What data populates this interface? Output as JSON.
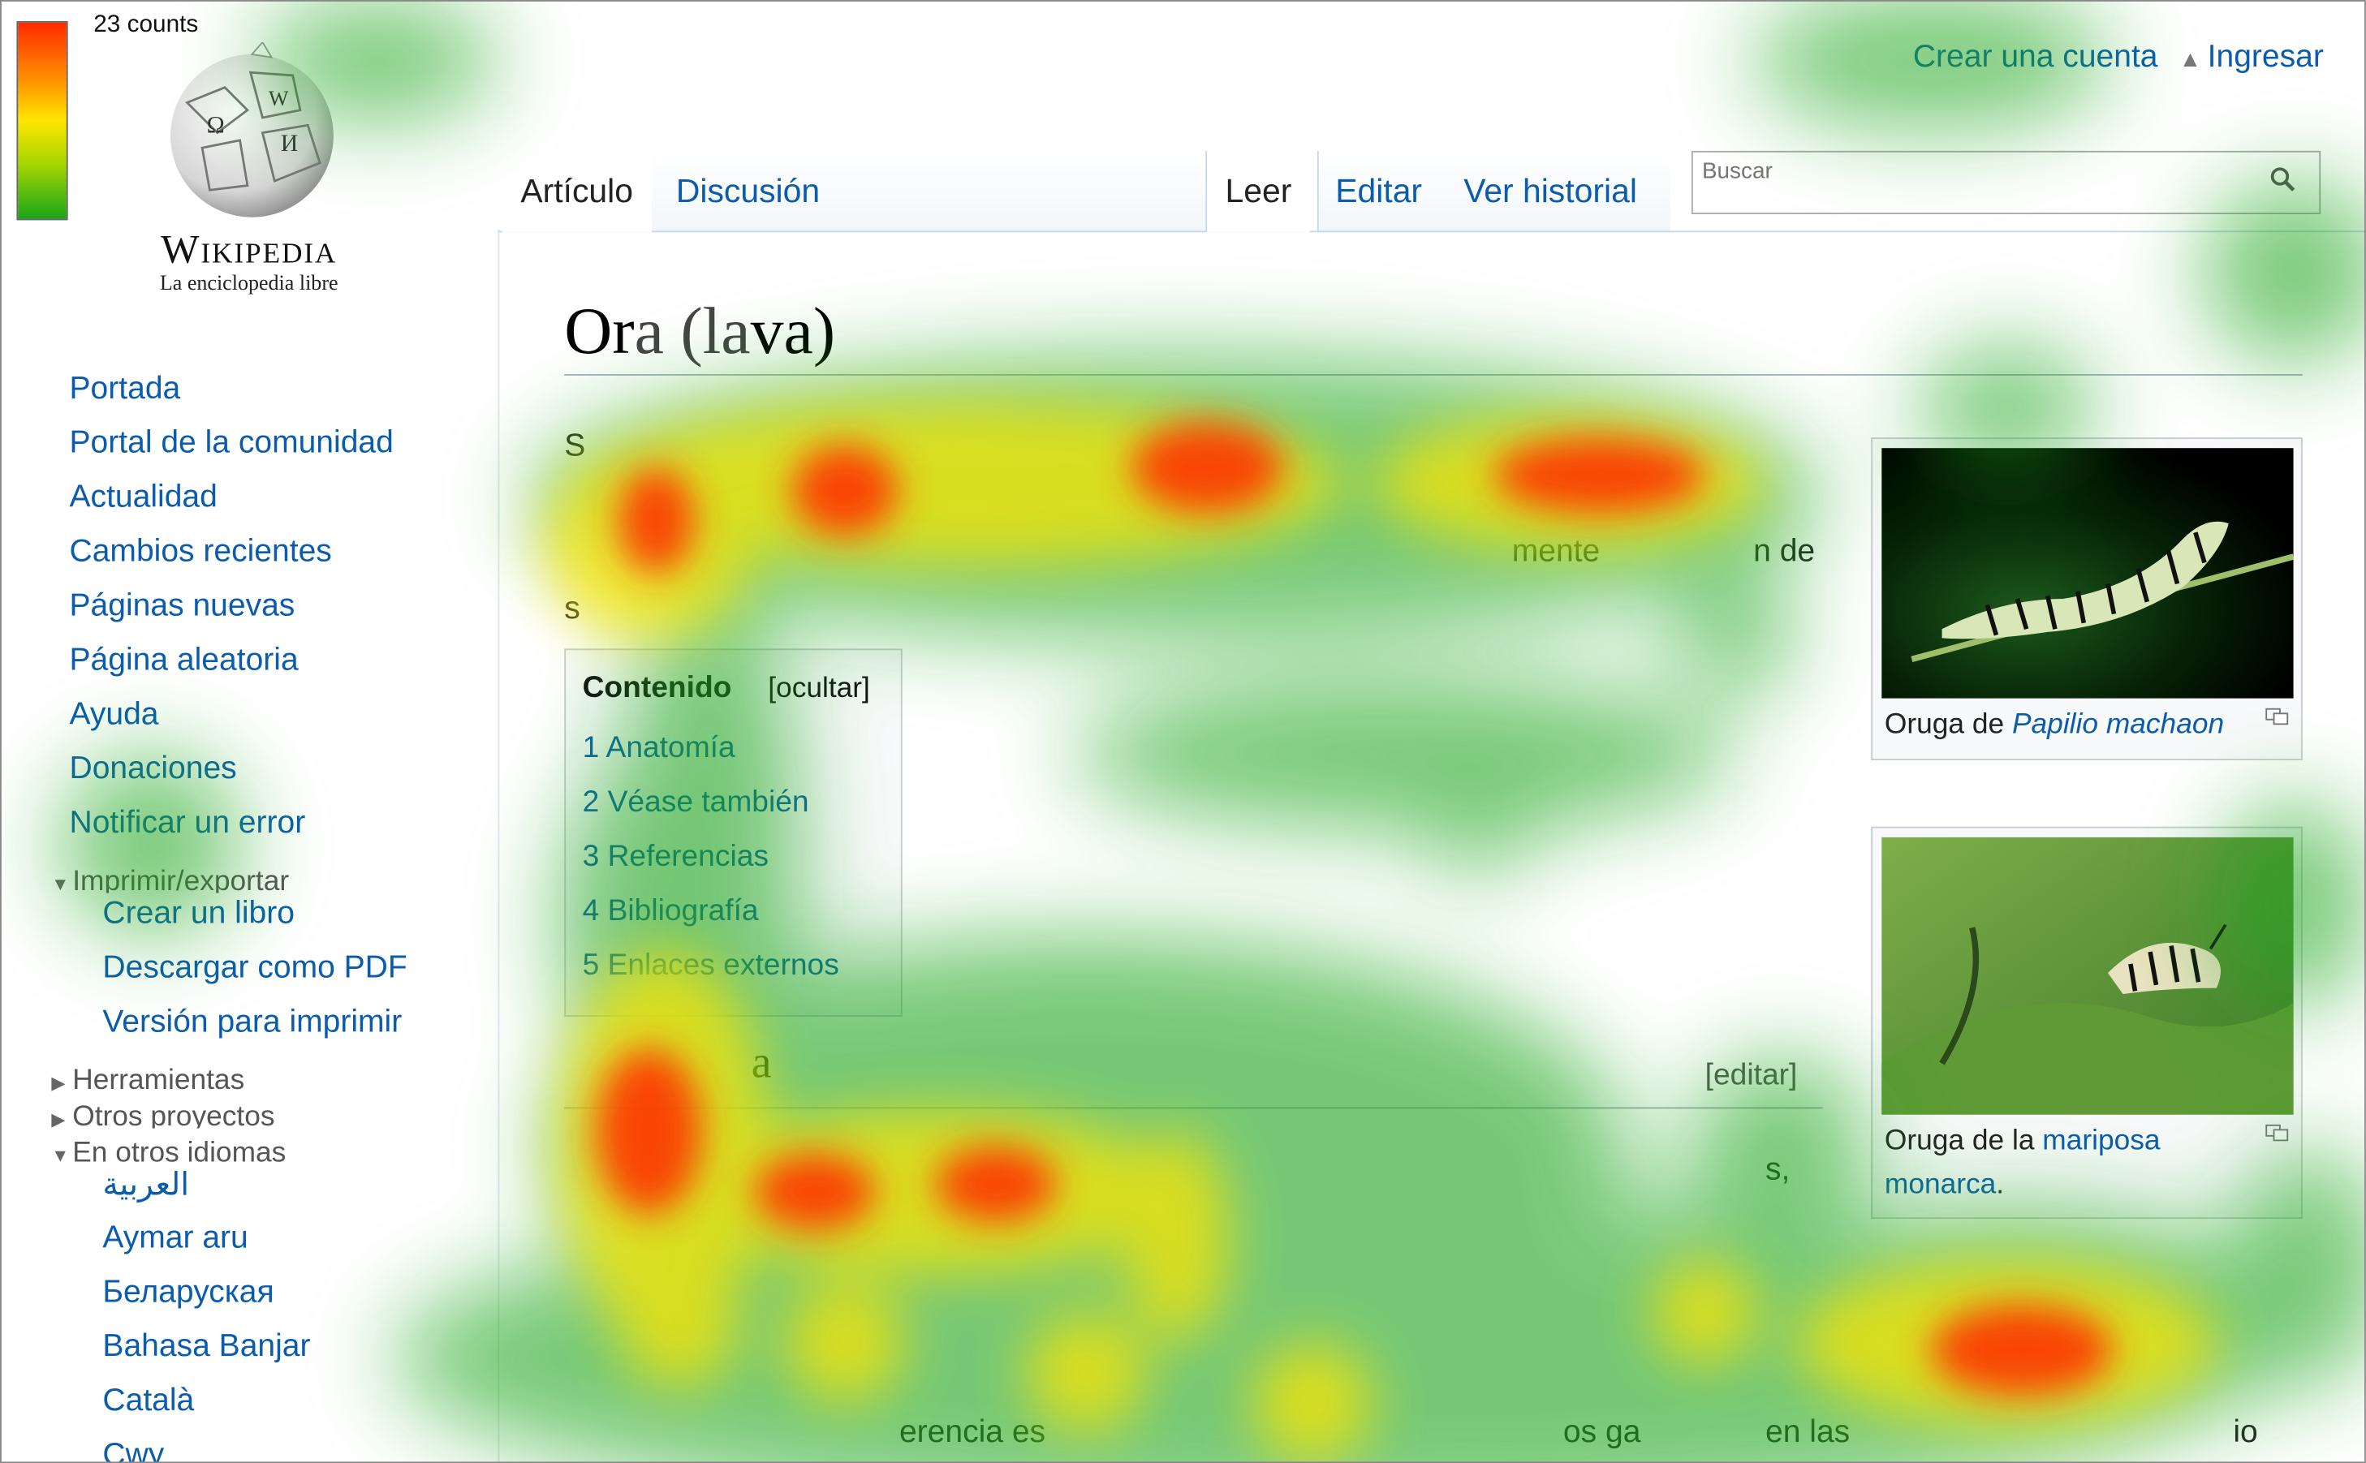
{
  "legend": {
    "label": "23 counts"
  },
  "logo": {
    "wordmark": "Wikipedia",
    "tagline": "La enciclopedia libre"
  },
  "personal_tools": {
    "create_account": "Crear una cuenta",
    "login": "Ingresar"
  },
  "tabs": {
    "left": [
      {
        "label": "Artículo",
        "selected": true
      },
      {
        "label": "Discusión",
        "selected": false
      }
    ],
    "right": [
      {
        "label": "Leer",
        "selected": true
      },
      {
        "label": "Editar",
        "selected": false
      },
      {
        "label": "Ver historial",
        "selected": false
      }
    ]
  },
  "search": {
    "placeholder": "Buscar",
    "icon": "magnifier-icon"
  },
  "sidebar": {
    "navigation": [
      "Portada",
      "Portal de la comunidad",
      "Actualidad",
      "Cambios recientes",
      "Páginas nuevas",
      "Página aleatoria",
      "Ayuda",
      "Donaciones",
      "Notificar un error"
    ],
    "print_export": {
      "heading": "Imprimir/exportar",
      "expanded": true,
      "items": [
        "Crear un libro",
        "Descargar como PDF",
        "Versión para imprimir"
      ]
    },
    "tools": {
      "heading": "Herramientas",
      "expanded": false
    },
    "other_projects": {
      "heading": "Otros proyectos",
      "expanded": false
    },
    "languages": {
      "heading": "En otros idiomas",
      "expanded": true,
      "items": [
        "العربية",
        "Aymar aru",
        "Беларуская",
        "Bahasa Banjar",
        "Català",
        "Cwy"
      ]
    }
  },
  "article": {
    "title_parts": [
      "Or",
      "a (la",
      "va)"
    ],
    "intro_fragments": [
      "S",
      "mente",
      "n de",
      "s"
    ],
    "toc": {
      "title": "Contenido",
      "toggle": "[ocultar]",
      "items": [
        "1 Anatomía",
        "2 Véase también",
        "3 Referencias",
        "4 Bibliografía",
        "5 Enlaces externos"
      ]
    },
    "section": {
      "heading_fragment": "a",
      "edit_label": "[editar]"
    },
    "body_fragments": [
      "s,",
      "erencia es",
      "os ga",
      "en las",
      "io"
    ],
    "thumbs": [
      {
        "caption_prefix": "Oruga de ",
        "caption_link": "Papilio machaon",
        "caption_suffix": ""
      },
      {
        "caption_prefix": "Oruga de la ",
        "caption_link": "mariposa monarca",
        "caption_suffix": "."
      }
    ]
  },
  "heatmap": {
    "max_count": 23,
    "colors": {
      "high": "#ff2a00",
      "mid": "#ffe600",
      "low": "#1aa51a"
    }
  }
}
